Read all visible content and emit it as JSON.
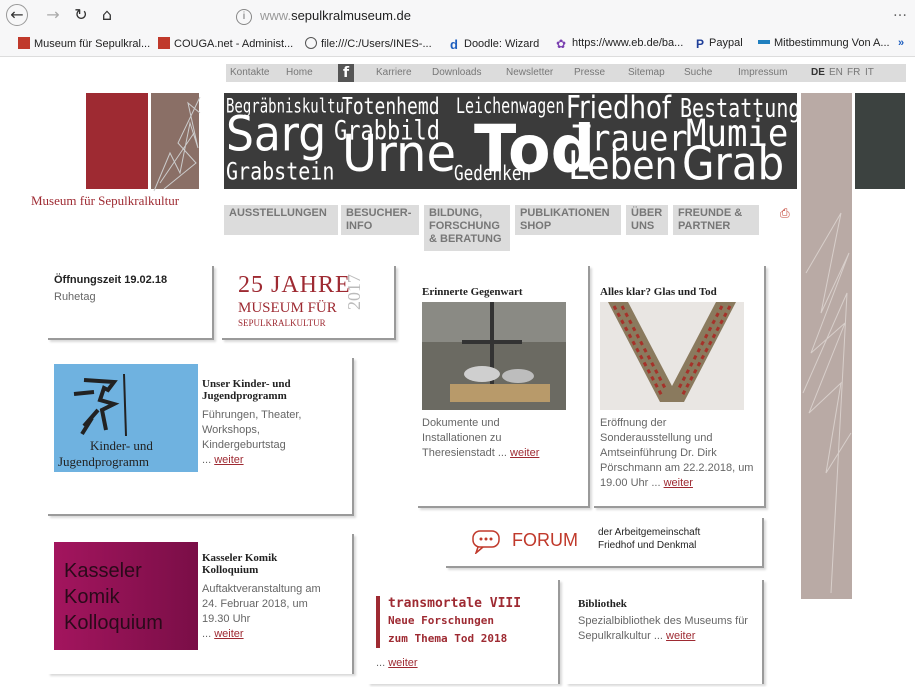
{
  "browser": {
    "url_prefix": "www.",
    "url_domain": "sepulkralmuseum.de",
    "menu": "…",
    "nav": {
      "back": "←",
      "forward": "→",
      "reload": "↻",
      "home": "⌂"
    },
    "bookmarks": [
      {
        "label": "Museum für Sepulkral...",
        "icon": "museum-icon",
        "color": "#c0392b"
      },
      {
        "label": "COUGA.net - Administ...",
        "icon": "couga-icon",
        "color": "#c0392b"
      },
      {
        "label": "file:///C:/Users/INES-...",
        "icon": "globe-icon",
        "color": "#555555"
      },
      {
        "label": "Doodle: Wizard",
        "icon": "doodle-icon",
        "color": "#1f5fbf"
      },
      {
        "label": "https://www.eb.de/ba...",
        "icon": "eb-icon",
        "color": "#7a3fb0"
      },
      {
        "label": "Paypal",
        "icon": "paypal-icon",
        "color": "#1f3f99"
      },
      {
        "label": "Mitbestimmung Von A...",
        "icon": "link-icon",
        "color": "#1f7fbf"
      }
    ]
  },
  "topnav": {
    "items": [
      "Kontakte",
      "Home",
      "Karriere",
      "Downloads",
      "Newsletter",
      "Presse",
      "Sitemap",
      "Suche",
      "Impressum"
    ],
    "fb": "f",
    "langs": [
      "DE",
      "EN",
      "FR",
      "IT"
    ]
  },
  "logo": {
    "text": "Museum für Sepulkralkultur"
  },
  "banner": {
    "words": [
      "Begräbniskultur",
      "Totenhemd",
      "Leichenwagen",
      "Friedhof",
      "Bestattung",
      "Sarg",
      "Grabbild",
      "Urne",
      "Tod",
      "Trauer",
      "Mumie",
      "Grabstein",
      "Gedenken",
      "Leben",
      "Grab"
    ]
  },
  "mainnav": {
    "items": [
      {
        "label": "AUSSTELLUNGEN"
      },
      {
        "label": "BESUCHER-\nINFO"
      },
      {
        "label": "BILDUNG,\nFORSCHUNG\n& BERATUNG"
      },
      {
        "label": "PUBLIKATIONEN\nSHOP"
      },
      {
        "label": "ÜBER\nUNS"
      },
      {
        "label": "FREUNDE &\nPARTNER"
      }
    ],
    "print_icon": "⎙"
  },
  "cards": {
    "opening": {
      "title": "Öffnungszeit 19.02.18",
      "text": "Ruhetag"
    },
    "anniversary": {
      "number": "25 JAHRE",
      "line2": "MUSEUM FÜR",
      "line3": "SEPULKRALKULTUR",
      "year": "2017"
    },
    "kinder": {
      "image_text1": "Kinder- und",
      "image_text2": "Jugendprogramm",
      "title": "Unser Kinder- und Jugendprogramm",
      "text": "Führungen, Theater, Workshops, Kindergeburtstag",
      "more": "weiter"
    },
    "erinnerte": {
      "title": "Erinnerte Gegenwart",
      "text": "Dokumente und Installationen zu Theresienstadt",
      "more": "weiter"
    },
    "allesklar": {
      "title": "Alles klar? Glas und Tod",
      "text": "Eröffnung der Sonderausstellung und Amtseinführung Dr. Dirk Pörschmann am 22.2.2018, um 19.00 Uhr",
      "more": "weiter"
    },
    "forum": {
      "label": "FORUM",
      "sub1": "der Arbeitgemeinschaft",
      "sub2": "Friedhof und Denkmal"
    },
    "komik": {
      "image_line1": "Kasseler",
      "image_line2": "Komik",
      "image_line3": "Kolloquium",
      "title": "Kasseler Komik Kolloquium",
      "text": "Auftaktveranstaltung am 24. Februar 2018, um 19.30 Uhr",
      "more": "weiter"
    },
    "transmortale": {
      "line1": "transmortale VIII",
      "line2": "Neue Forschungen",
      "line3": "zum Thema Tod 2018",
      "more": "weiter"
    },
    "bibliothek": {
      "title": "Bibliothek",
      "text": "Spezialbibliothek des Museums für Sepulkralkultur",
      "more": "weiter"
    }
  },
  "colors": {
    "brand": "#9e2a32",
    "banner": "#3b3b3b",
    "pink": "#b9aaa5",
    "magenta": "#a3155e"
  }
}
